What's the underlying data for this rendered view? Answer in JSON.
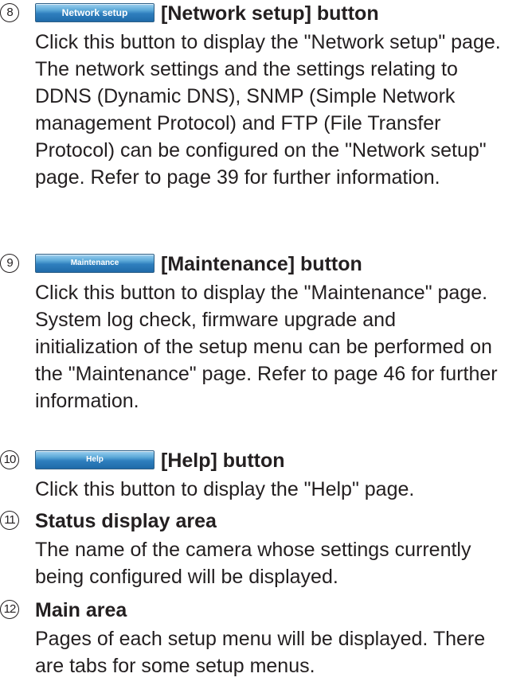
{
  "items": [
    {
      "number": "8",
      "button_label": "Network setup",
      "title": "[Network setup] button",
      "lines": "Click this button to display the \"Network setup\" page.\nThe network settings and the settings relating to\nDDNS (Dynamic DNS), SNMP (Simple Network\nmanagement Protocol) and FTP (File Transfer\nProtocol) can be configured on the \"Network setup\"\npage. Refer to page 39 for further information."
    },
    {
      "number": "9",
      "button_label": "Maintenance",
      "title": "[Maintenance] button",
      "lines": "Click this button to display the \"Maintenance\" page.\nSystem log check, firmware upgrade and\ninitialization of the setup menu can be performed on\nthe \"Maintenance\" page. Refer to page 46 for further\ninformation."
    },
    {
      "number": "10",
      "button_label": "Help",
      "title": "[Help] button",
      "lines": "Click this button to display the \"Help\" page."
    },
    {
      "number": "11",
      "title": "Status display area",
      "lines": "The name of the camera whose settings currently\nbeing configured will be displayed."
    },
    {
      "number": "12",
      "title": "Main area",
      "lines": "Pages of each setup menu will be displayed. There\nare tabs for some setup menus."
    }
  ]
}
